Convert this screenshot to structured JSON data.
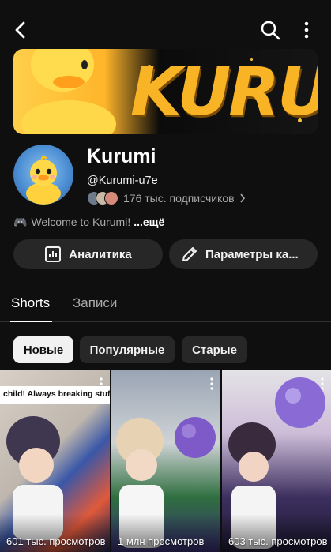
{
  "header": {
    "icons": [
      "back-arrow-icon",
      "search-icon",
      "more-vertical-icon"
    ]
  },
  "banner": {
    "brand_text": "KURUI"
  },
  "channel": {
    "name": "Kurumi",
    "handle": "@Kurumi-u7e",
    "subscribers": "176 тыс. подписчиков",
    "description_emoji": "🎮",
    "description": "Welcome to Kurumi!",
    "more_label": "...ещё"
  },
  "actions": {
    "analytics_label": "Аналитика",
    "settings_label": "Параметры ка..."
  },
  "tabs": [
    {
      "label": "Shorts",
      "active": true
    },
    {
      "label": "Записи",
      "active": false
    }
  ],
  "filters": [
    {
      "label": "Новые",
      "selected": true
    },
    {
      "label": "Популярные",
      "selected": false
    },
    {
      "label": "Старые",
      "selected": false
    }
  ],
  "shorts": [
    {
      "views": "601 тыс. просмотров",
      "caption": "child! Always breaking stuff!"
    },
    {
      "views": "1 млн просмотров"
    },
    {
      "views": "603 тыс. просмотров"
    }
  ],
  "colors": {
    "background": "#0f0f0f",
    "button_bg": "#272727",
    "selected_chip_bg": "#f1f1f1",
    "banner_accent": "#f8b425"
  }
}
